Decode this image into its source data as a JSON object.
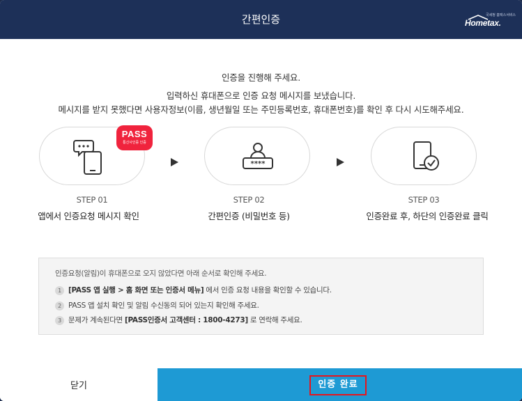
{
  "header": {
    "title": "간편인증",
    "logo_text": "Hometax.",
    "logo_tagline": "국세청 홈택스서비스"
  },
  "message": {
    "line1": "인증을 진행해 주세요.",
    "line2": "입력하신 휴대폰으로 인증 요청 메시지를 보냈습니다.",
    "line3": "메시지를 받지 못했다면 사용자정보(이름, 생년월일 또는 주민등록번호, 휴대폰번호)를 확인 후 다시 시도해주세요."
  },
  "pass_badge": {
    "title": "PASS",
    "subtitle": "통신사인증 인증"
  },
  "steps": [
    {
      "number": "STEP 01",
      "description": "앱에서 인증요청 메시지 확인",
      "icon": "phone-message-icon"
    },
    {
      "number": "STEP 02",
      "description": "간편인증 (비밀번호 등)",
      "icon": "password-user-icon"
    },
    {
      "number": "STEP 03",
      "description": "인증완료 후, 하단의 인증완료 클릭",
      "icon": "phone-check-icon"
    }
  ],
  "info": {
    "intro": "인증요청(알림)이 휴대폰으로 오지 않았다면 아래 순서로 확인해 주세요.",
    "items": [
      {
        "num": "1",
        "bold": "[PASS 앱 실행 > 홈 화면 또는 인증서 메뉴]",
        "text": " 에서 인증 요청 내용을 확인할 수 있습니다."
      },
      {
        "num": "2",
        "bold": "",
        "text": "PASS 앱 설치 확인 및 알림 수신동의 되어 있는지 확인해 주세요."
      },
      {
        "num": "3",
        "pre": "문제가 계속된다면 ",
        "bold": "[PASS인증서 고객센터 : 1800-4273]",
        "text": " 로 연락해 주세요."
      }
    ]
  },
  "footer": {
    "close_label": "닫기",
    "done_label": "인증 완료"
  },
  "colors": {
    "header_bg": "#1d3058",
    "done_button_bg": "#1e9ad4",
    "highlight_border": "#e8141b",
    "pass_red": "#f0233d"
  }
}
